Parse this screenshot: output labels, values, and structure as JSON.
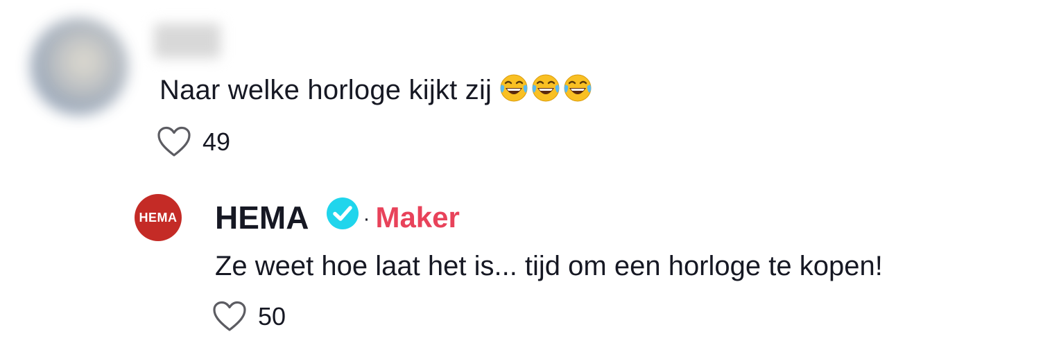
{
  "comment": {
    "text": "Naar welke horloge kijkt zij",
    "emojis": [
      "face-with-tears-of-joy",
      "face-with-tears-of-joy",
      "face-with-tears-of-joy"
    ],
    "likes": "49"
  },
  "reply": {
    "author": "HEMA",
    "avatar_text": "HEMA",
    "badge": "Maker",
    "separator": "·",
    "text": "Ze weet hoe laat het is... tijd om een horloge te kopen!",
    "likes": "50"
  },
  "colors": {
    "brand_red": "#c42b26",
    "maker_pink": "#e8425a",
    "verified_blue": "#20d5ec",
    "text": "#161823"
  },
  "icons": {
    "like": "heart-outline-icon",
    "verified": "verified-check-icon"
  }
}
